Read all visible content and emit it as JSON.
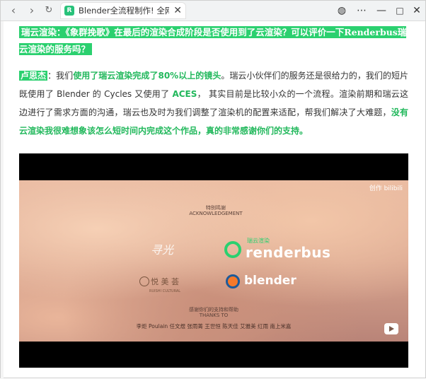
{
  "browser": {
    "tab_title": "Blender全流程制作! 全网百万",
    "favicon_text": "R"
  },
  "article": {
    "question": "瑞云渲染：《象群挽歌》在最后的渲染合成阶段是否使用到了云渲染？可以评价一下Renderbus瑞云渲染的服务吗？",
    "speaker": "卢思杰",
    "answer_parts": {
      "p1": "：我们",
      "p2": "使用了瑞云渲染完成了80%以上的镜头",
      "p3": "。瑞云小伙伴们的服务还是很给力的，我们的短片既使用了 Blender 的 Cycles 又使用了 ",
      "p4": "ACES",
      "p5": "， 其实目前是比较小众的一个流程。渲染前期和瑞云这边进行了需求方面的沟通，瑞云也及时为我们调整了渲染机的配置来适配，帮我们解决了大难题，",
      "p6": "没有云渲染我很难想象该怎么短时间内完成这个作品，真的非常感谢你们的支持。"
    }
  },
  "video": {
    "ack_cn": "特别鸣谢",
    "ack_en": "ACKNOWLEDGEMENT",
    "renderbus_small": "瑞云渲染",
    "renderbus": "renderbus",
    "blender": "blender",
    "yue": "悦 美 荟",
    "yue_sub": "RUISHI CULTURAL",
    "script_logo": "寻光",
    "thanks_cn": "感谢你们的支持和帮助",
    "thanks_en": "THANKS TO",
    "names": "李炬 Poulain 任文煜 张雨菁 王世恒 陈天佳 艾雅美 红雨 南上米嘉",
    "bili": "创作 bilibili"
  },
  "colors": {
    "accent": "#2bd06f",
    "accent_text": "#22b85c"
  }
}
